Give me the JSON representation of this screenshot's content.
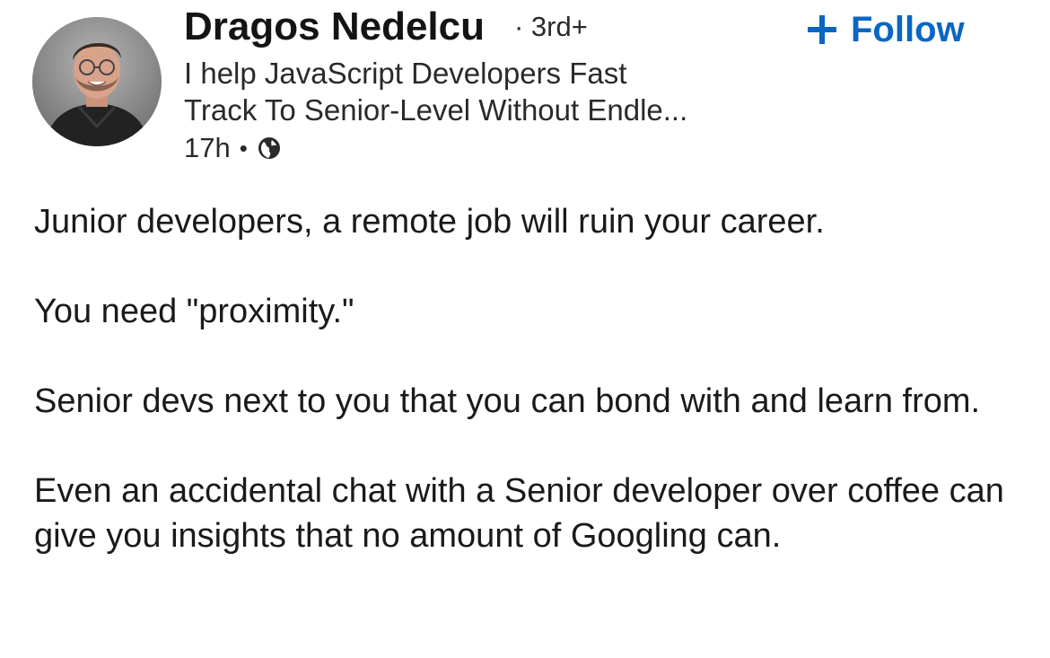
{
  "author": {
    "name": "Dragos Nedelcu",
    "degree": "· 3rd+",
    "headline_line1": "I help JavaScript Developers Fast",
    "headline_line2": "Track To Senior-Level Without Endle...",
    "time": "17h",
    "visibility_icon": "globe-icon"
  },
  "follow": {
    "label": "Follow",
    "icon": "plus-icon",
    "color": "#0a66c2"
  },
  "post": {
    "paragraphs": [
      "Junior developers, a remote job will ruin your career.",
      "You need \"proximity.\"",
      "Senior devs next to you that you can bond with and learn from.",
      "Even an accidental chat with a Senior developer over coffee can give you insights that no amount of Googling can."
    ]
  }
}
